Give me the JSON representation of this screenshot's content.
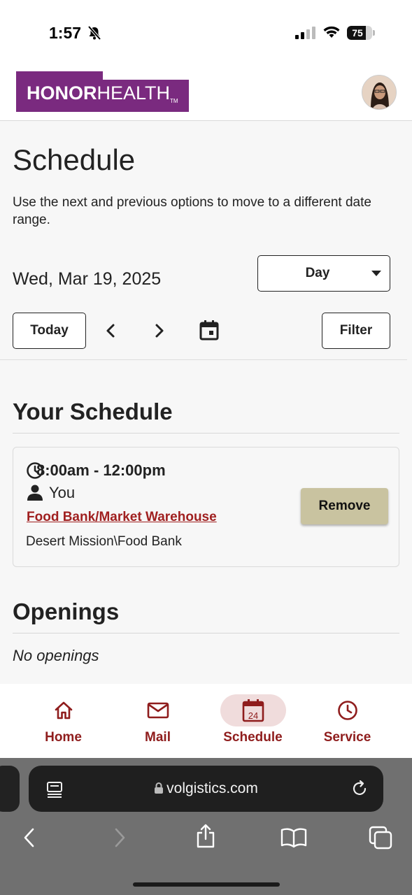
{
  "status_bar": {
    "time": "1:57",
    "battery": "75",
    "battery_level": 0.75
  },
  "header": {
    "logo_bold": "HONOR",
    "logo_light": "HEALTH",
    "logo_tm": "TM",
    "brand_color": "#7a2a7f"
  },
  "schedule": {
    "title": "Schedule",
    "intro": "Use the next and previous options to move to a different date range.",
    "date": "Wed, Mar 19, 2025",
    "view_select": "Day",
    "today_label": "Today",
    "filter_label": "Filter"
  },
  "your_schedule": {
    "title": "Your Schedule",
    "shift": {
      "time": "8:00am - 12:00pm",
      "who": "You",
      "assignment": "Food Bank/Market Warehouse",
      "location": "Desert Mission\\Food Bank",
      "remove_label": "Remove"
    }
  },
  "openings": {
    "title": "Openings",
    "empty_text": "No openings"
  },
  "bottom_nav": {
    "items": [
      {
        "label": "Home",
        "icon": "home-icon"
      },
      {
        "label": "Mail",
        "icon": "mail-icon"
      },
      {
        "label": "Schedule",
        "icon": "calendar-icon",
        "badge": "24",
        "active": true
      },
      {
        "label": "Service",
        "icon": "clock-icon"
      }
    ],
    "accent_color": "#8f1d1d"
  },
  "browser": {
    "url": "volgistics.com"
  }
}
